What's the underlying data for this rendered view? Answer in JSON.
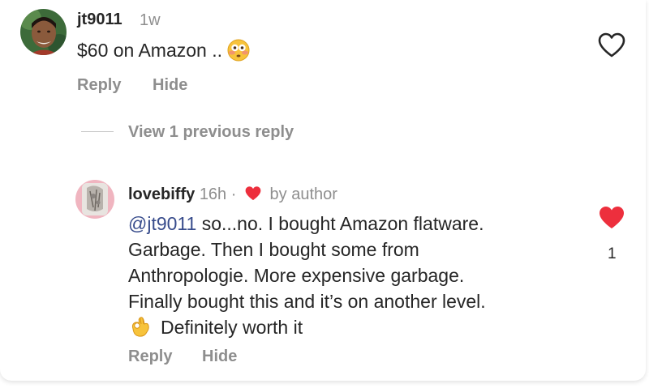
{
  "comment": {
    "username": "jt9011",
    "time": "1w",
    "text": "$60 on Amazon ..",
    "emoji": "flushed-face",
    "reply_label": "Reply",
    "hide_label": "Hide",
    "liked": false
  },
  "view_replies_label": "View 1 previous reply",
  "reply": {
    "username": "lovebiffy",
    "time": "16h",
    "separator": "·",
    "liked_by_author_label": "by author",
    "mention": "@jt9011",
    "lines": [
      " so...no. I bought Amazon flatware.",
      "Garbage. Then I bought some from",
      "Anthropologie. More expensive garbage.",
      "Finally bought this and it’s on another level.",
      "Definitely worth it"
    ],
    "emoji": "ok-hand",
    "reply_label": "Reply",
    "hide_label": "Hide",
    "liked": true,
    "like_count": "1"
  },
  "colors": {
    "heart_red": "#ed2f3d",
    "secondary_text": "#8e8e8e",
    "mention_blue": "#384c8c"
  }
}
